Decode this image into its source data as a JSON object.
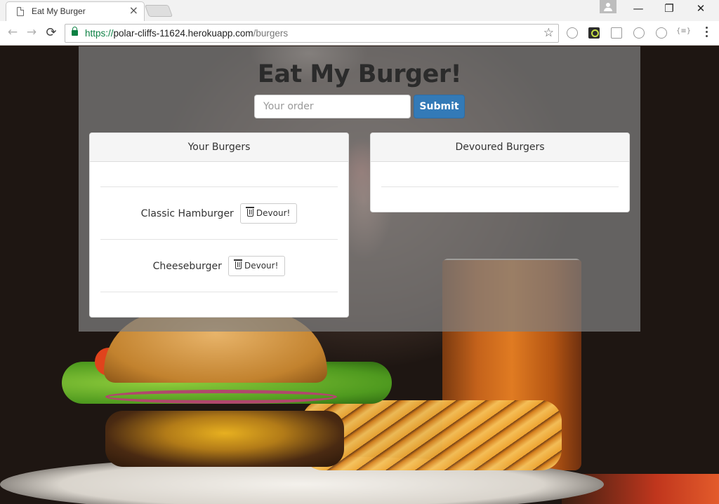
{
  "browser": {
    "tab_title": "Eat My Burger",
    "tab_close": "×",
    "window_controls": {
      "minimize": "—",
      "restore": "❐",
      "close": "✕"
    },
    "nav": {
      "back": "←",
      "forward": "→",
      "reload": "⟳"
    },
    "url": {
      "scheme": "https://",
      "host": "polar-cliffs-11624.herokuapp.com",
      "path": "/burgers"
    },
    "bookmark_star": "☆",
    "extensions": [
      "search-ext-icon",
      "green-ext-icon",
      "box-ext-icon",
      "shield-ext-icon",
      "zoom-ext-icon",
      "json-ext-icon"
    ],
    "json_ext_text": "{≡}"
  },
  "app": {
    "title": "Eat My Burger!",
    "order_placeholder": "Your order",
    "order_value": "",
    "submit_label": "Submit"
  },
  "panels": {
    "your_burgers": {
      "heading": "Your Burgers",
      "items": [
        {
          "name": "Classic Hamburger",
          "button_label": "Devour!"
        },
        {
          "name": "Cheeseburger",
          "button_label": "Devour!"
        }
      ]
    },
    "devoured_burgers": {
      "heading": "Devoured Burgers",
      "items": []
    }
  },
  "colors": {
    "accent": "#337ab7",
    "secure_green": "#0b8043",
    "overlay": "rgba(128,128,128,0.72)"
  }
}
